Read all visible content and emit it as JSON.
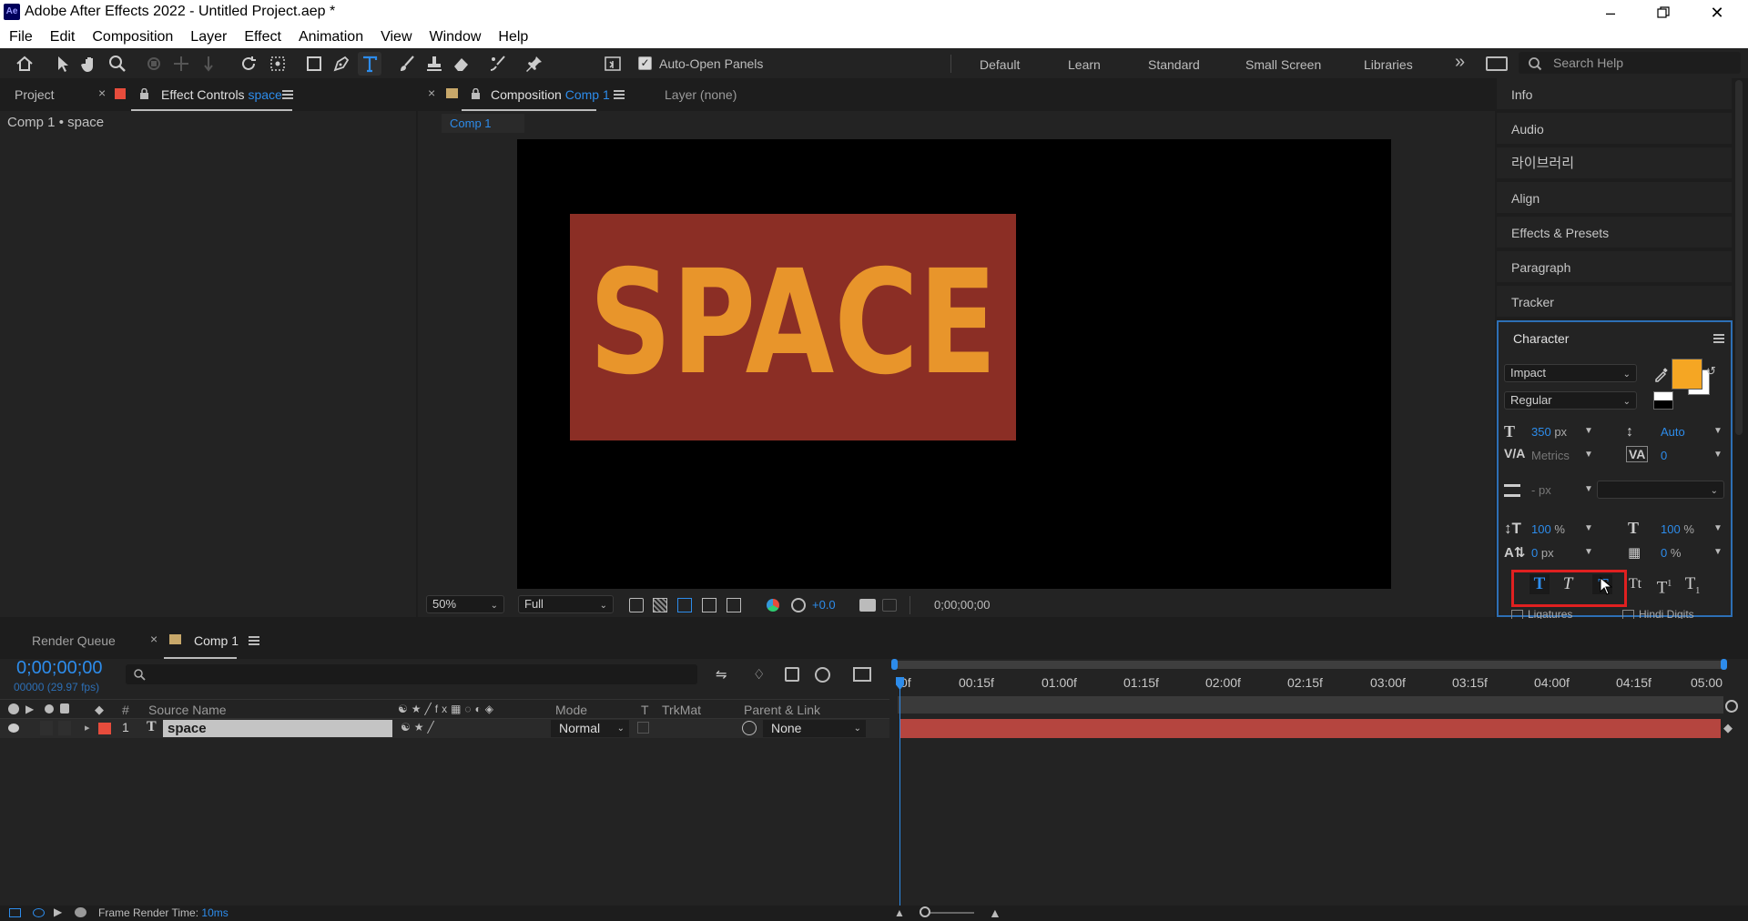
{
  "window": {
    "title": "Adobe After Effects 2022 - Untitled Project.aep *",
    "logo": "Ae",
    "controls": [
      "minimize-icon",
      "restore-icon",
      "close-icon"
    ]
  },
  "menu": [
    "File",
    "Edit",
    "Composition",
    "Layer",
    "Effect",
    "Animation",
    "View",
    "Window",
    "Help"
  ],
  "toolbar": {
    "auto_open_label": "Auto-Open Panels",
    "workspaces": [
      "Default",
      "Learn",
      "Standard",
      "Small Screen",
      "Libraries"
    ],
    "more": "»",
    "search_placeholder": "Search Help"
  },
  "left_panel": {
    "tab_project": "Project",
    "tab_effect_controls": "Effect Controls",
    "effect_layer": "space",
    "breadcrumb": "Comp 1 • space"
  },
  "comp_panel": {
    "tab_prefix": "Composition",
    "comp_name": "Comp 1",
    "layer_tab": "Layer (none)",
    "subtab": "Comp 1",
    "canvas_text": "SPACE",
    "zoom": "50%",
    "resolution": "Full",
    "exposure": "+0.0",
    "timecode": "0;00;00;00"
  },
  "right_panels": [
    "Info",
    "Audio",
    "라이브러리",
    "Align",
    "Effects & Presets",
    "Paragraph",
    "Tracker"
  ],
  "character": {
    "title": "Character",
    "font": "Impact",
    "style": "Regular",
    "size": "350",
    "size_unit": "px",
    "leading": "Auto",
    "kerning": "Metrics",
    "tracking": "0",
    "stroke": "-",
    "stroke_unit": "px",
    "vscale": "100",
    "hscale": "100",
    "pct": "%",
    "baseline": "0",
    "baseline_unit": "px",
    "tsume": "0",
    "styles": [
      "T",
      "T",
      "T",
      "Tt",
      "T",
      "T"
    ],
    "superscript_mark": "1",
    "subscript_mark": "1",
    "ligatures": "Ligatures",
    "hindi_digits": "Hindi Digits",
    "fill_color": "#f5a623"
  },
  "timeline": {
    "render_queue_tab": "Render Queue",
    "comp_tab": "Comp 1",
    "time": "0;00;00;00",
    "frames": "00000 (29.97 fps)",
    "columns": {
      "hash": "#",
      "source": "Source Name",
      "mode": "Mode",
      "t": "T",
      "trkmat": "TrkMat",
      "parent": "Parent & Link"
    },
    "layers": [
      {
        "index": "1",
        "type": "T",
        "name": "space",
        "mode": "Normal",
        "parent": "None",
        "label_color": "#e74c3c"
      }
    ],
    "ruler": [
      "0f",
      "00:15f",
      "01:00f",
      "01:15f",
      "02:00f",
      "02:15f",
      "03:00f",
      "03:15f",
      "04:00f",
      "04:15f",
      "05:00"
    ],
    "status_label": "Frame Render Time:",
    "status_value": "10ms"
  },
  "colors": {
    "accent": "#2d8ceb",
    "highlight_box": "#e02020",
    "text_box_bg": "#8b2e25",
    "text_fill": "#e8952b",
    "layer_bar": "#b5453f"
  }
}
